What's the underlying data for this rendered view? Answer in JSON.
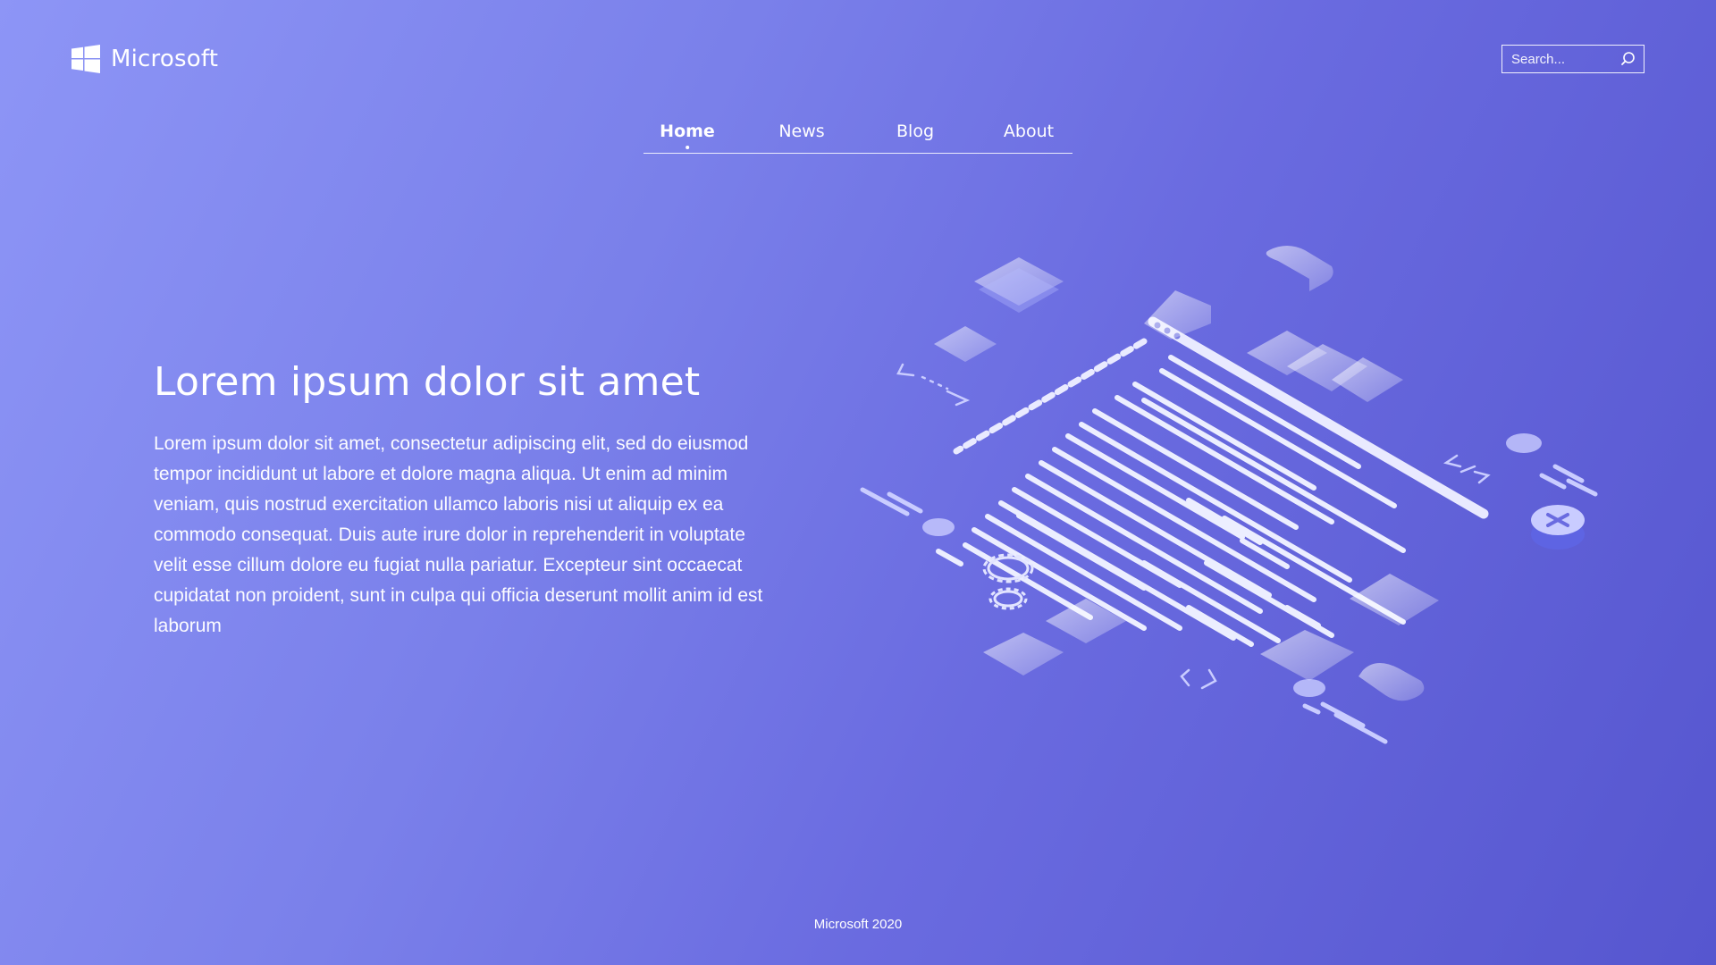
{
  "brand": {
    "name": "Microsoft",
    "logo_icon": "windows-logo-icon"
  },
  "search": {
    "placeholder": "Search...",
    "icon": "search-icon"
  },
  "nav": {
    "items": [
      {
        "label": "Home",
        "active": true
      },
      {
        "label": "News",
        "active": false
      },
      {
        "label": "Blog",
        "active": false
      },
      {
        "label": "About",
        "active": false
      }
    ]
  },
  "hero": {
    "title": "Lorem ipsum dolor sit amet",
    "body": "Lorem ipsum dolor sit amet, consectetur adipiscing elit, sed do eiusmod tempor incididunt ut labore et dolore magna aliqua. Ut enim ad minim veniam, quis nostrud exercitation ullamco laboris nisi ut aliquip ex ea commodo consequat. Duis aute irure dolor in reprehenderit in voluptate velit esse cillum dolore eu fugiat nulla pariatur. Excepteur sint occaecat cupidatat non proident, sunt in culpa qui officia deserunt mollit anim id est laborum"
  },
  "illustration": {
    "icon": "isometric-code-illustration",
    "symbols": [
      "</>",
      "</>",
      "[ ]"
    ]
  },
  "footer": {
    "text": "Microsoft 2020"
  },
  "colors": {
    "background_start": "#8d95f6",
    "background_end": "#5656cf",
    "foreground": "#ffffff"
  }
}
